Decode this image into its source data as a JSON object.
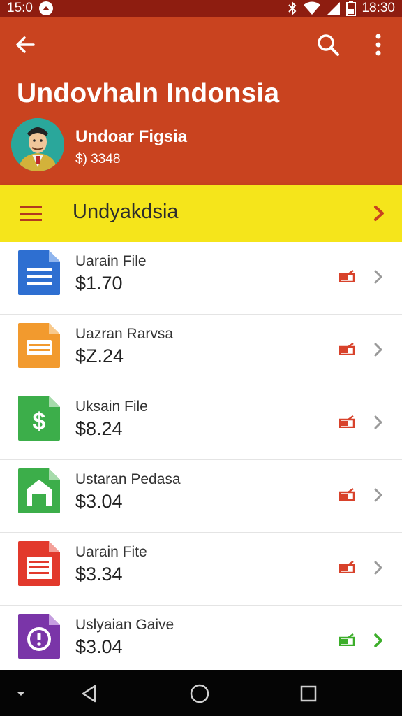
{
  "status_bar": {
    "time_left": "15:0",
    "time_right": "18:30",
    "icons": [
      "app-icon",
      "bluetooth-icon",
      "wifi-icon",
      "signal-icon",
      "battery-icon"
    ]
  },
  "header": {
    "title": "Undovhaln Indonsia",
    "subtitle": "Undoar Figsia",
    "amount": "$) 3348",
    "icons": [
      "back-arrow-icon",
      "search-icon",
      "more-vert-icon"
    ],
    "color": "#c9431f"
  },
  "banner": {
    "label": "Undyakdsia",
    "color": "#f5e51b"
  },
  "items": [
    {
      "name": "Uarain File",
      "price": "$1.70",
      "icon": "blue-doc-icon",
      "color": "#2e6fd1",
      "status": "red"
    },
    {
      "name": "Uazran Rarvsa",
      "price": "$Z.24",
      "icon": "orange-doc-icon",
      "color": "#f29a2e",
      "status": "red"
    },
    {
      "name": "Uksain File",
      "price": "$8.24",
      "icon": "green-dollar-icon",
      "color": "#3cae4a",
      "status": "red"
    },
    {
      "name": "Ustaran Pedasa",
      "price": "$3.04",
      "icon": "green-home-icon",
      "color": "#3cae4a",
      "status": "red"
    },
    {
      "name": "Uarain Fite",
      "price": "$3.34",
      "icon": "red-doc-icon",
      "color": "#e2392c",
      "status": "red"
    },
    {
      "name": "Uslyaian Gaive",
      "price": "$3.04",
      "icon": "purple-alert-icon",
      "color": "#7a35a8",
      "status": "green"
    }
  ],
  "nav_bar": {
    "icons": [
      "dropdown-icon",
      "back-triangle-icon",
      "home-circle-icon",
      "recents-square-icon"
    ]
  }
}
